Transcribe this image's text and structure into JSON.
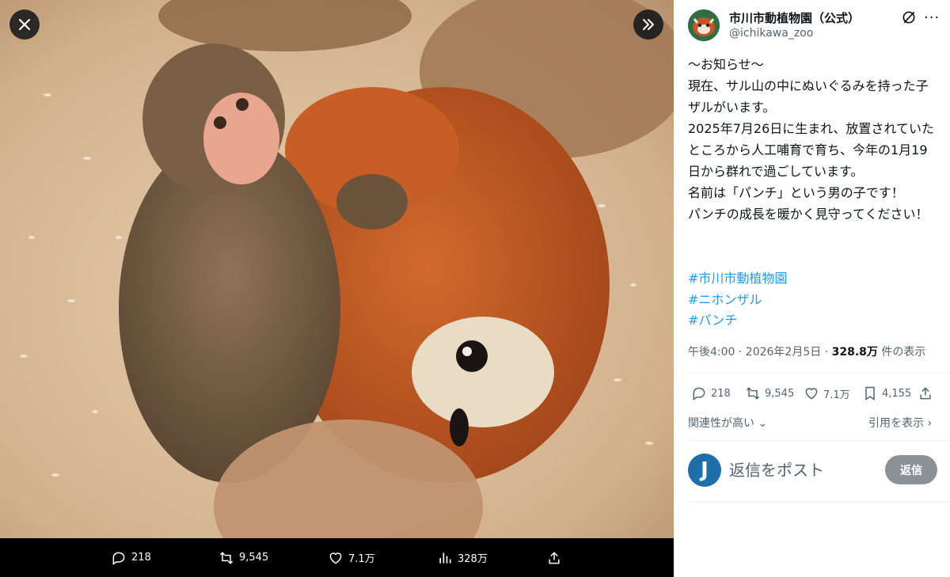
{
  "media": {
    "stats": {
      "replies": "218",
      "reposts": "9,545",
      "likes": "7.1万",
      "views": "328万"
    }
  },
  "account": {
    "display_name": "市川市動植物園（公式）",
    "handle": "@ichikawa_zoo"
  },
  "tweet": {
    "lines": [
      "〜お知らせ〜",
      "現在、サル山の中にぬいぐるみを持った子ザルがいます。",
      "2025年7月26日に生まれ、放置されていたところから人工哺育で育ち、今年の1月19日から群れで過ごしています。",
      "名前は「パンチ」という男の子です！",
      "パンチの成長を暖かく見守ってください！"
    ],
    "hashtags": [
      "#市川市動植物園",
      "#ニホンザル",
      "#パンチ"
    ],
    "time": "午後4:00 · 2026年2月5日 · ",
    "views": "328.8万",
    "views_suffix": " 件の表示"
  },
  "actions": {
    "replies": "218",
    "reposts": "9,545",
    "likes": "7.1万",
    "bookmarks": "4,155"
  },
  "sort_label": "関連性が高い",
  "quotes_label": "引用を表示",
  "reply": {
    "avatar_letter": "J",
    "placeholder": "返信をポスト",
    "button": "返信"
  },
  "icons": {
    "close": "close-icon",
    "expand": "chevron-double-right-icon",
    "reply": "reply-icon",
    "repost": "repost-icon",
    "like": "heart-icon",
    "views": "analytics-icon",
    "share": "share-icon",
    "bookmark": "bookmark-icon",
    "grok": "grok-icon",
    "more": "more-icon"
  }
}
